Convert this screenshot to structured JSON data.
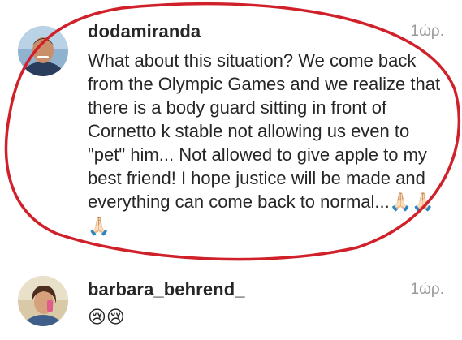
{
  "comments": [
    {
      "username": "dodamiranda",
      "time": "1ώρ.",
      "text": "What about this situation? We come back from the Olympic Games and we realize that there is a body guard sitting in front of Cornetto k stable not allowing us even to \"pet\" him... Not allowed to give apple to my best friend! I hope justice will be made and everything can come back to normal...",
      "emoji": "🙏🏻🙏🏻🙏🏻"
    },
    {
      "username": "barbara_behrend_",
      "time": "1ώρ.",
      "text": "",
      "emoji": "😢😢"
    }
  ],
  "colors": {
    "highlight": "#d0202a",
    "username": "#262626",
    "timestamp": "#999999"
  }
}
